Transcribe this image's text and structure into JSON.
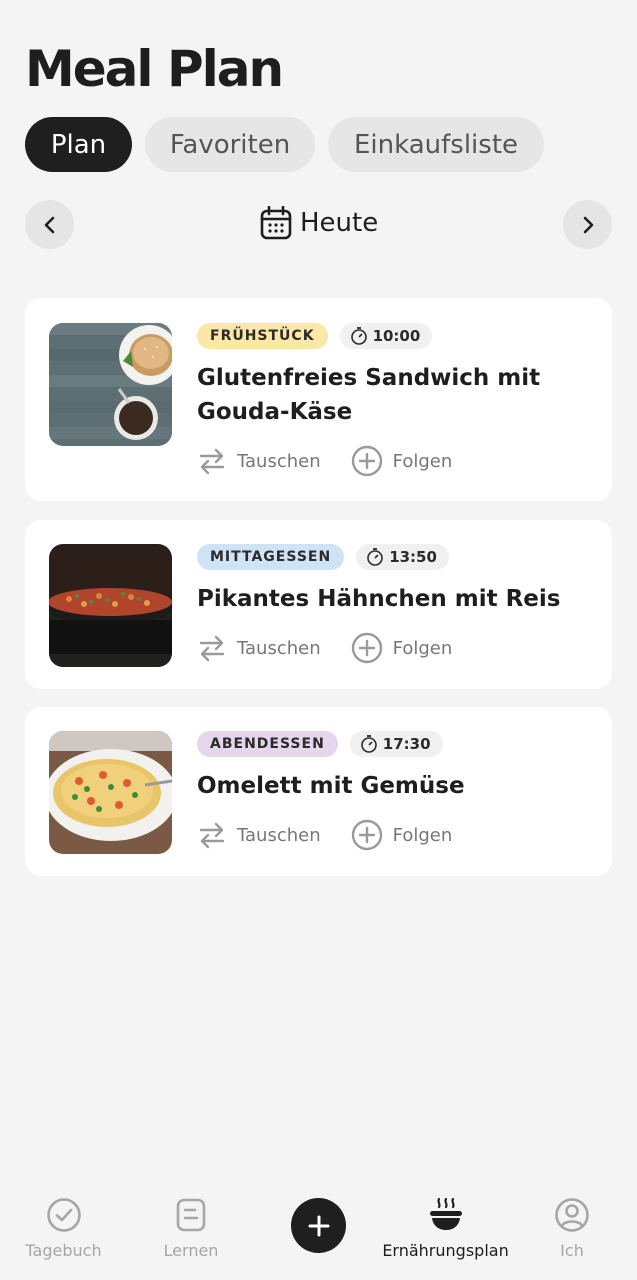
{
  "header": {
    "title": "Meal Plan"
  },
  "tabs": [
    {
      "label": "Plan",
      "active": true
    },
    {
      "label": "Favoriten",
      "active": false
    },
    {
      "label": "Einkaufsliste",
      "active": false
    }
  ],
  "date_nav": {
    "label": "Heute",
    "prev_icon": "chevron-left-icon",
    "next_icon": "chevron-right-icon",
    "calendar_icon": "calendar-icon"
  },
  "meals": [
    {
      "tag": "FRÜHSTÜCK",
      "tag_color": "#fbe8a6",
      "time": "10:00",
      "title_line1": "Glutenfreies Sandwich mit",
      "title_line2": "Gouda-Käse",
      "swap_label": "Tauschen",
      "follow_label": "Folgen"
    },
    {
      "tag": "MITTAGESSEN",
      "tag_color": "#cfe3f7",
      "time": "13:50",
      "title_line1": "Pikantes Hähnchen mit Reis",
      "swap_label": "Tauschen",
      "follow_label": "Folgen"
    },
    {
      "tag": "ABENDESSEN",
      "tag_color": "#e6d6ec",
      "time": "17:30",
      "title_line1": "Omelett mit Gemüse",
      "swap_label": "Tauschen",
      "follow_label": "Folgen"
    }
  ],
  "bottom_nav": [
    {
      "label": "Tagebuch",
      "icon": "check-circle-icon",
      "active": false
    },
    {
      "label": "Lernen",
      "icon": "document-icon",
      "active": false
    },
    {
      "label": "",
      "icon": "plus-icon",
      "active": false
    },
    {
      "label": "Ernährungsplan",
      "icon": "bowl-icon",
      "active": true
    },
    {
      "label": "Ich",
      "icon": "user-icon",
      "active": false
    }
  ],
  "colors": {
    "background": "#f4f4f4",
    "accent": "#1f1f1f",
    "card": "#ffffff"
  }
}
